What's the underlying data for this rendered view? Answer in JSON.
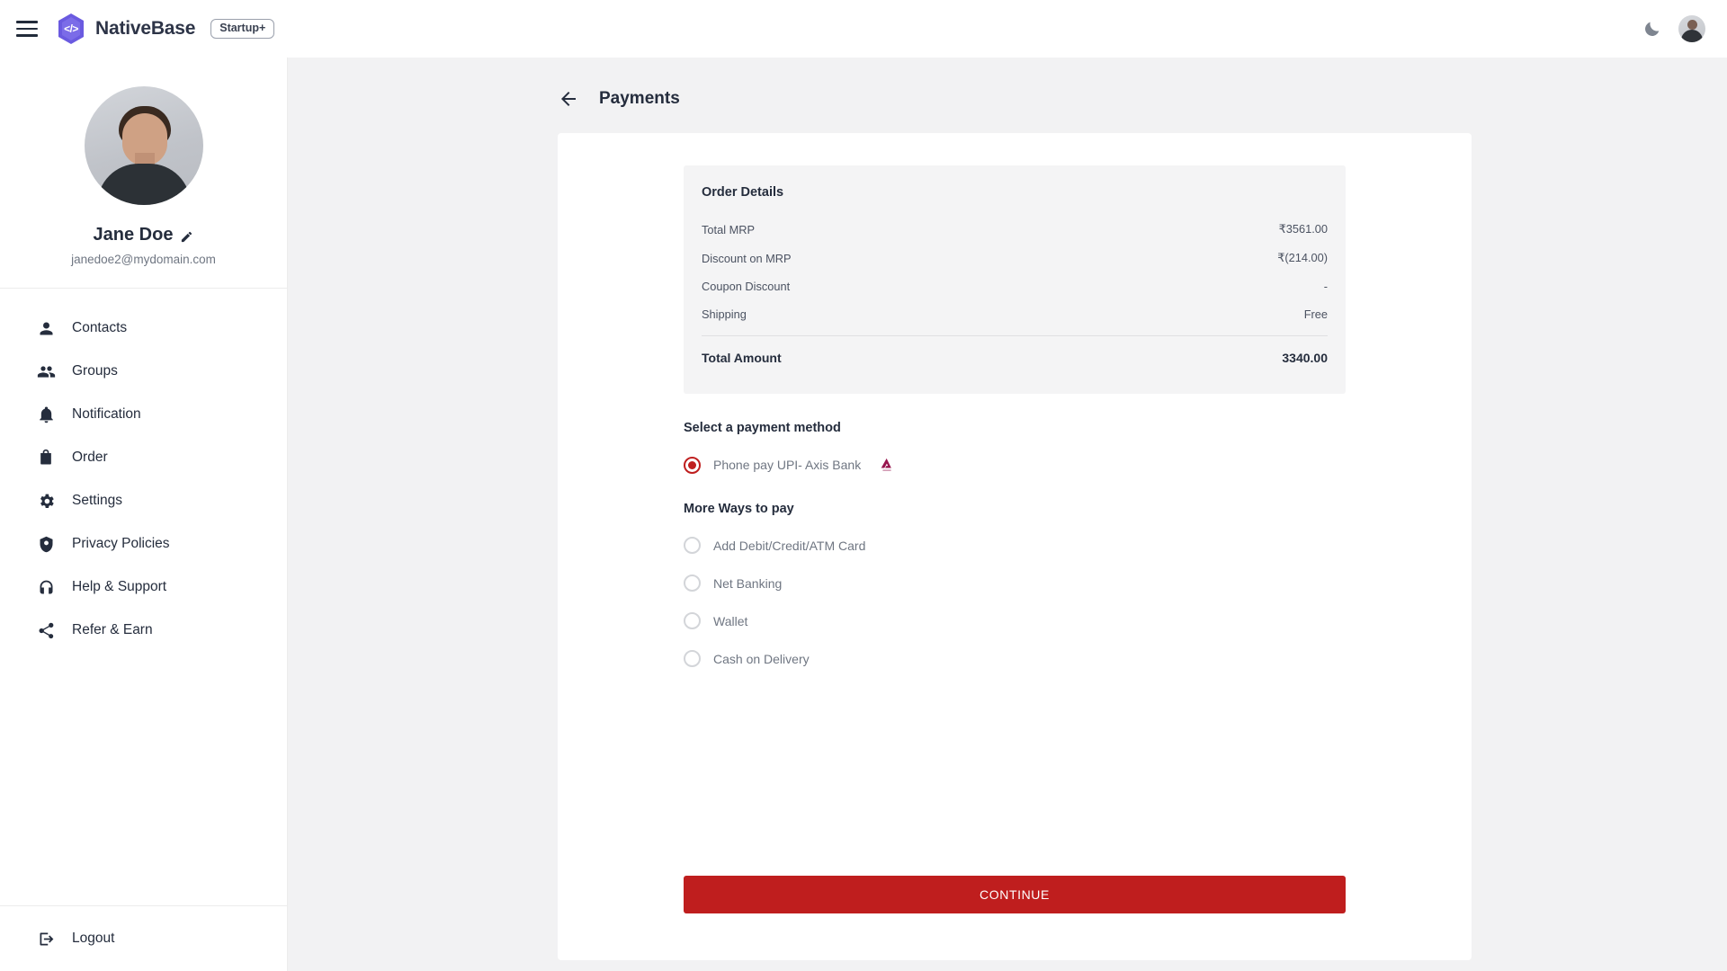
{
  "topbar": {
    "menu_icon": "hamburger-icon",
    "logo_icon": "nativebase-hex-logo",
    "logo_glyph": "</>",
    "brand": "NativeBase",
    "badge": "Startup+",
    "theme_toggle_icon": "moon-icon",
    "avatar_icon": "user-avatar"
  },
  "sidebar": {
    "profile": {
      "avatar_icon": "profile-photo",
      "name": "Jane Doe",
      "edit_icon": "pencil-icon",
      "email": "janedoe2@mydomain.com"
    },
    "items": [
      {
        "label": "Contacts",
        "icon": "person-icon"
      },
      {
        "label": "Groups",
        "icon": "people-group-icon"
      },
      {
        "label": "Notification",
        "icon": "bell-icon"
      },
      {
        "label": "Order",
        "icon": "shopping-bag-icon"
      },
      {
        "label": "Settings",
        "icon": "gear-icon"
      },
      {
        "label": "Privacy Policies",
        "icon": "shield-icon"
      },
      {
        "label": "Help & Support",
        "icon": "headset-icon"
      },
      {
        "label": "Refer & Earn",
        "icon": "share-icon"
      }
    ],
    "logout": {
      "label": "Logout",
      "icon": "logout-icon"
    }
  },
  "page": {
    "back_icon": "arrow-left-icon",
    "title": "Payments"
  },
  "order_details": {
    "title": "Order Details",
    "rows": [
      {
        "label": "Total MRP",
        "value": "₹3561.00"
      },
      {
        "label": "Discount on MRP",
        "value": "₹(214.00)"
      },
      {
        "label": "Coupon Discount",
        "value": "-"
      },
      {
        "label": "Shipping",
        "value": "Free"
      }
    ],
    "total": {
      "label": "Total Amount",
      "value": "3340.00"
    }
  },
  "payment": {
    "select_title": "Select a payment method",
    "selected": {
      "label": "Phone pay UPI- Axis Bank",
      "bank_logo_icon": "axis-bank-logo",
      "checked": true
    },
    "more_title": "More Ways to pay",
    "options": [
      {
        "label": "Add Debit/Credit/ATM Card",
        "checked": false
      },
      {
        "label": "Net Banking",
        "checked": false
      },
      {
        "label": "Wallet",
        "checked": false
      },
      {
        "label": "Cash on Delivery",
        "checked": false
      }
    ]
  },
  "continue_button": {
    "label": "CONTINUE"
  },
  "colors": {
    "accent_red": "#bf1e1e",
    "brand_purple": "#6a5ae0",
    "page_bg": "#f2f2f3",
    "text_dark": "#252d3d",
    "text_muted": "#6f7682",
    "axis_maroon": "#97144d"
  }
}
